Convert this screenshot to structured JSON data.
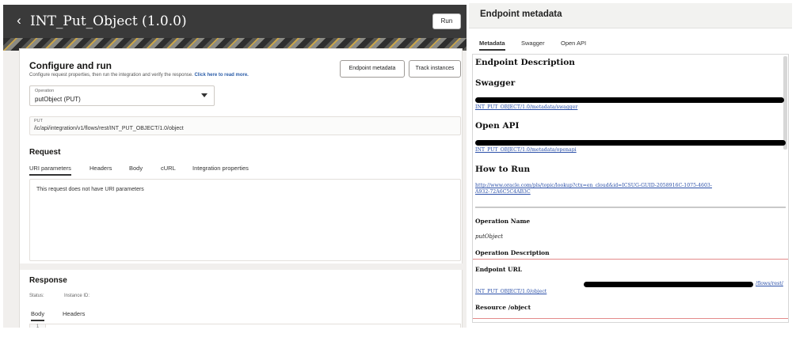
{
  "header": {
    "title": "INT_Put_Object (1.0.0)",
    "back_icon": "chevron-left-icon",
    "run_label": "Run"
  },
  "configure": {
    "title": "Configure and run",
    "subtitle": "Configure request properties, then run the integration and verify the response.",
    "subtitle_link": "Click here to read more.",
    "endpoint_metadata_label": "Endpoint metadata",
    "track_instances_label": "Track instances"
  },
  "operation": {
    "label": "Operation",
    "value": "putObject (PUT)"
  },
  "put": {
    "method": "PUT",
    "path": "/ic/api/integration/v1/flows/rest/INT_PUT_OBJECT/1.0/object"
  },
  "request": {
    "title": "Request",
    "tabs": [
      "URI parameters",
      "Headers",
      "Body",
      "cURL",
      "Integration properties"
    ],
    "empty_message": "This request does not have URI parameters"
  },
  "response": {
    "title": "Response",
    "status_label": "Status:",
    "instance_label": "Instance ID:",
    "tabs": [
      "Body",
      "Headers"
    ],
    "gutter": "1"
  },
  "metadata_panel": {
    "title": "Endpoint metadata",
    "tabs": [
      "Metadata",
      "Swagger",
      "Open API"
    ],
    "endpoint_description": "Endpoint Description",
    "swagger_heading": "Swagger",
    "swagger_link": "INT_PUT_OBJECT/1.0/metadata/swagger",
    "openapi_heading": "Open API",
    "openapi_link": "INT_PUT_OBJECT/1.0/metadata/openapi",
    "how_to_run_heading": "How to Run",
    "how_to_run_link_1": "http://www.oracle.com/pls/topic/lookup?ctx=en_cloud&id=ICSUG-GUID-2058916C-1075-4603-",
    "how_to_run_link_2": "A932-72A6C5C4AB3C",
    "operation_name_label": "Operation Name",
    "operation_name_value": "putObject",
    "operation_description_label": "Operation Description",
    "endpoint_url_label": "Endpoint URL",
    "endpoint_url_tail": "/flows/rest/",
    "endpoint_url_line2": "INT_PUT_OBJECT/1.0/object",
    "resource_label": "Resource /object"
  }
}
